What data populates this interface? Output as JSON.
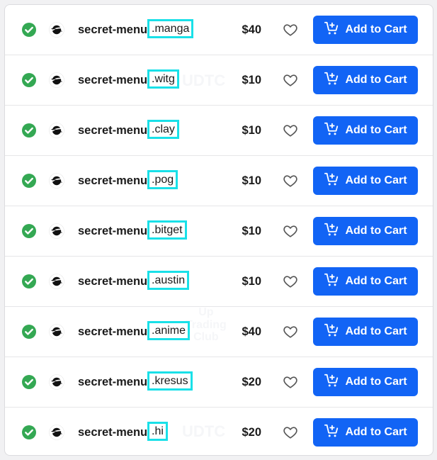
{
  "colors": {
    "accent": "#1264f5",
    "success": "#34a853",
    "highlight": "#19e0e8"
  },
  "icons": {
    "status": "check-circle-icon",
    "logo": "project-logo-icon",
    "favorite": "heart-icon",
    "cart": "cart-plus-icon"
  },
  "cart_button_label": "Add to Cart",
  "domains": [
    {
      "prefix": "secret-menu",
      "tld": ".manga",
      "price": "$40"
    },
    {
      "prefix": "secret-menu",
      "tld": ".witg",
      "price": "$10"
    },
    {
      "prefix": "secret-menu",
      "tld": ".clay",
      "price": "$10"
    },
    {
      "prefix": "secret-menu",
      "tld": ".pog",
      "price": "$10"
    },
    {
      "prefix": "secret-menu",
      "tld": ".bitget",
      "price": "$10"
    },
    {
      "prefix": "secret-menu",
      "tld": ".austin",
      "price": "$10"
    },
    {
      "prefix": "secret-menu",
      "tld": ".anime",
      "price": "$40"
    },
    {
      "prefix": "secret-menu",
      "tld": ".kresus",
      "price": "$20"
    },
    {
      "prefix": "secret-menu",
      "tld": ".hi",
      "price": "$20"
    }
  ]
}
